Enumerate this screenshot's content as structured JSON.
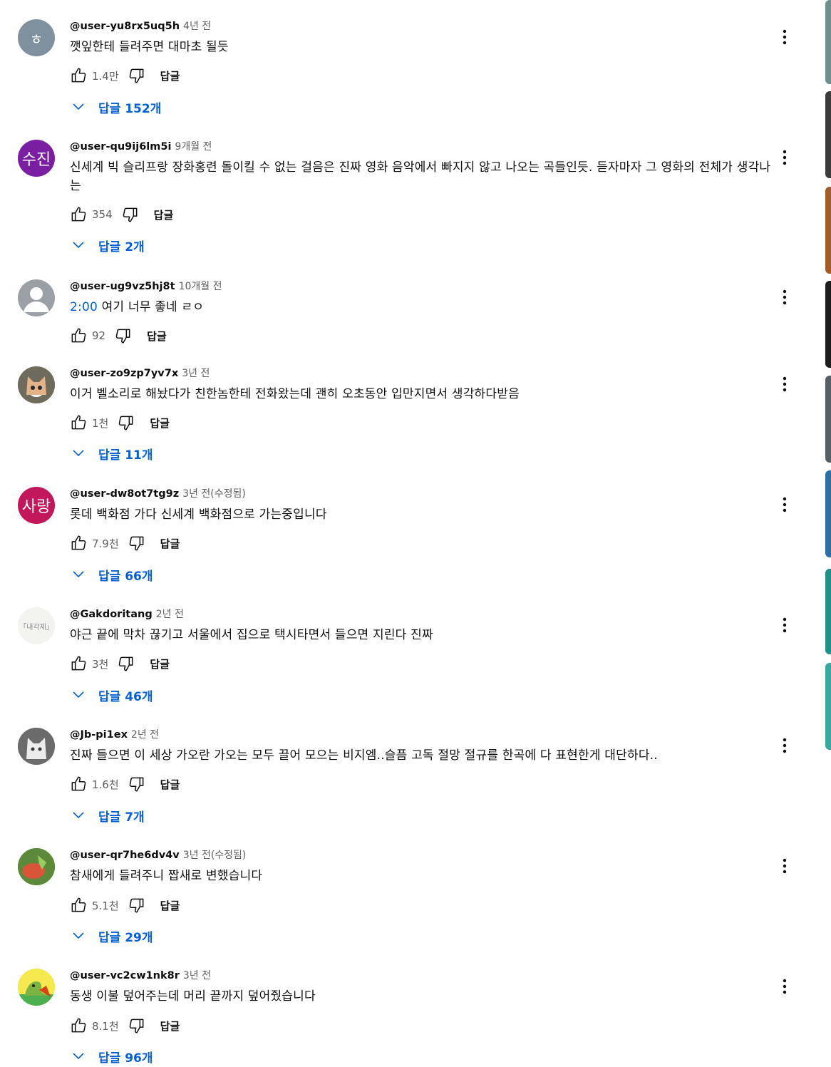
{
  "labels": {
    "reply": "답글"
  },
  "comments": [
    {
      "author": "@user-yu8rx5uq5h",
      "time": "4년 전",
      "text": "깻잎한테 들려주면 대마초 될듯",
      "likes": "1.4만",
      "replies": "답글 152개",
      "avatar": {
        "letter": "ㅎ",
        "color": "#7f919e"
      }
    },
    {
      "author": "@user-qu9ij6lm5i",
      "time": "9개월 전",
      "text": "신세계 빅 슬리프랑 장화홍련 돌이킬 수 없는 걸음은 진짜 영화 음악에서 빠지지 않고 나오는 곡들인듯. 듣자마자 그 영화의 전체가 생각나는",
      "likes": "354",
      "replies": "답글 2개",
      "avatar": {
        "letter": "수진",
        "color": "#7b1fa2"
      }
    },
    {
      "author": "@user-ug9vz5hj8t",
      "time": "10개월 전",
      "timestamp": "2:00",
      "text": " 여기 너무 좋네 ㄹㅇ",
      "likes": "92",
      "replies": "",
      "avatar": {
        "letter": "",
        "color": "#9aa0a6"
      }
    },
    {
      "author": "@user-zo9zp7yv7x",
      "time": "3년 전",
      "text": "이거 벨소리로 해놨다가 친한놈한테 전화왔는데 괜히 오초동안 입만지면서 생각하다받음",
      "likes": "1천",
      "replies": "답글 11개",
      "avatar": {
        "letter": "",
        "color": "#c9a27e"
      }
    },
    {
      "author": "@user-dw8ot7tg9z",
      "time": "3년 전(수정됨)",
      "text": "롯데 백화점 가다 신세계 백화점으로 가는중입니다",
      "likes": "7.9천",
      "replies": "답글 66개",
      "avatar": {
        "letter": "사랑",
        "color": "#c2185b"
      }
    },
    {
      "author": "@Gakdoritang",
      "time": "2년 전",
      "text": "야근 끝에 막차 끊기고 서울에서 집으로 택시타면서 들으면 지린다 진짜",
      "likes": "3천",
      "replies": "답글 46개",
      "avatar": {
        "letter": "「내각제」",
        "color": "#f3f3f0"
      }
    },
    {
      "author": "@Jb-pi1ex",
      "time": "2년 전",
      "text": "진짜 들으면 이 세상 가오란 가오는 모두 끌어 모으는 비지엠..슬픔 고독 절망 절규를 한곡에 다 표현한게 대단하다..",
      "likes": "1.6천",
      "replies": "답글 7개",
      "avatar": {
        "letter": "",
        "color": "#8a8a8a"
      }
    },
    {
      "author": "@user-qr7he6dv4v",
      "time": "3년 전(수정됨)",
      "text": "참새에게 들려주니 짭새로 변했습니다",
      "likes": "5.1천",
      "replies": "답글 29개",
      "avatar": {
        "letter": "",
        "color": "#7aa64a"
      }
    },
    {
      "author": "@user-vc2cw1nk8r",
      "time": "3년 전",
      "text": "동생 이불 덮어주는데 머리 끝까지 덮어줬습니다",
      "likes": "8.1천",
      "replies": "답글 96개",
      "avatar": {
        "letter": "",
        "color": "#f2e24a"
      }
    }
  ],
  "colors": {
    "link": "#065fd4",
    "secondary": "#606060",
    "text": "#0f0f0f"
  }
}
